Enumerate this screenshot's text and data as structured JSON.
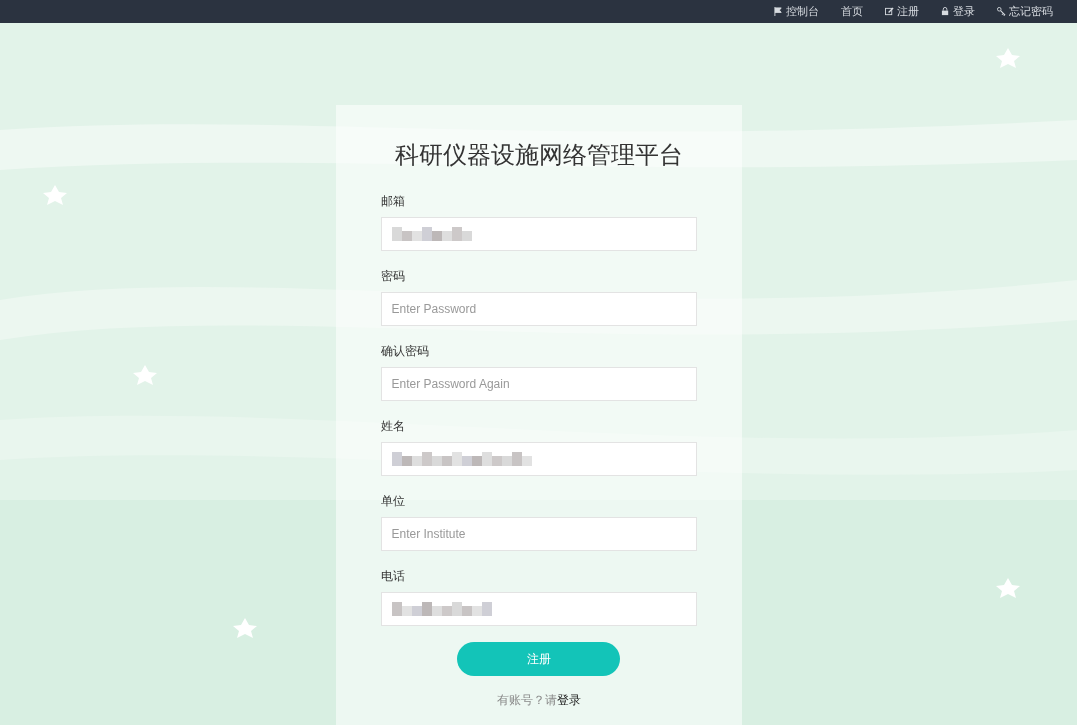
{
  "navbar": {
    "links": [
      {
        "label": "控制台"
      },
      {
        "label": "首页"
      },
      {
        "label": "注册"
      },
      {
        "label": "登录"
      },
      {
        "label": "忘记密码"
      }
    ]
  },
  "form": {
    "title": "科研仪器设施网络管理平台",
    "fields": [
      {
        "label": "邮箱",
        "blurred": true
      },
      {
        "label": "密码",
        "placeholder": "Enter Password",
        "blurred": false
      },
      {
        "label": "确认密码",
        "placeholder": "Enter Password Again",
        "blurred": false
      },
      {
        "label": "姓名",
        "blurred": true
      },
      {
        "label": "单位",
        "placeholder": "Enter Institute",
        "blurred": false
      },
      {
        "label": "电话",
        "blurred": true
      }
    ],
    "submit": "注册",
    "footer": {
      "text": "有账号？请",
      "link": "登录"
    }
  }
}
